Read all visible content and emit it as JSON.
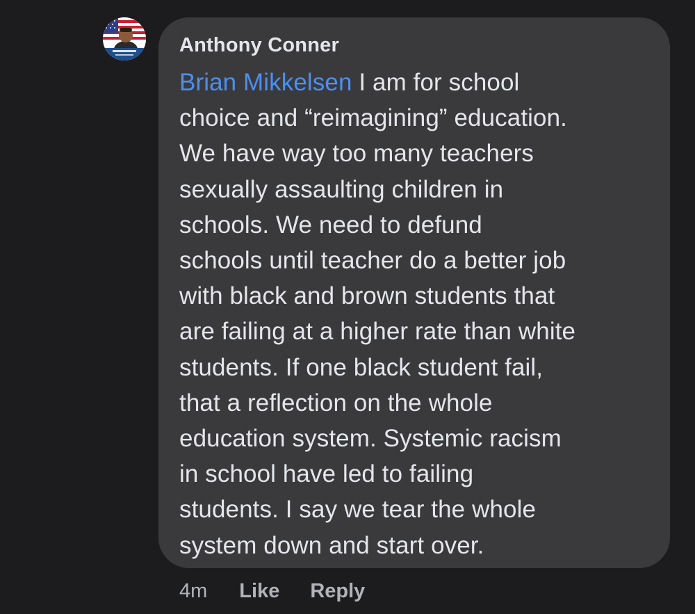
{
  "comment": {
    "author": "Anthony Conner",
    "mention": "Brian Mikkelsen",
    "text_lines": [
      " I am for school",
      "choice and “reimagining” education.",
      "We have way too many teachers",
      "sexually assaulting children in",
      "schools.  We need to defund",
      "schools until teacher do a better job",
      "with black and brown students that",
      "are failing at a higher rate than white",
      "students.  If one black student fail,",
      "that a reflection on the whole",
      "education system.  Systemic racism",
      "in school have led to failing",
      "students.   I say we tear the whole",
      "system down and start over."
    ],
    "avatar_icon": "profile-photo-american-flag"
  },
  "actions": {
    "time": "4m",
    "like_label": "Like",
    "reply_label": "Reply"
  },
  "colors": {
    "background": "#1c1c1e",
    "bubble": "#3a3a3c",
    "text": "#e4e6eb",
    "mention": "#4d8ff0",
    "meta": "#b0b3b8"
  }
}
